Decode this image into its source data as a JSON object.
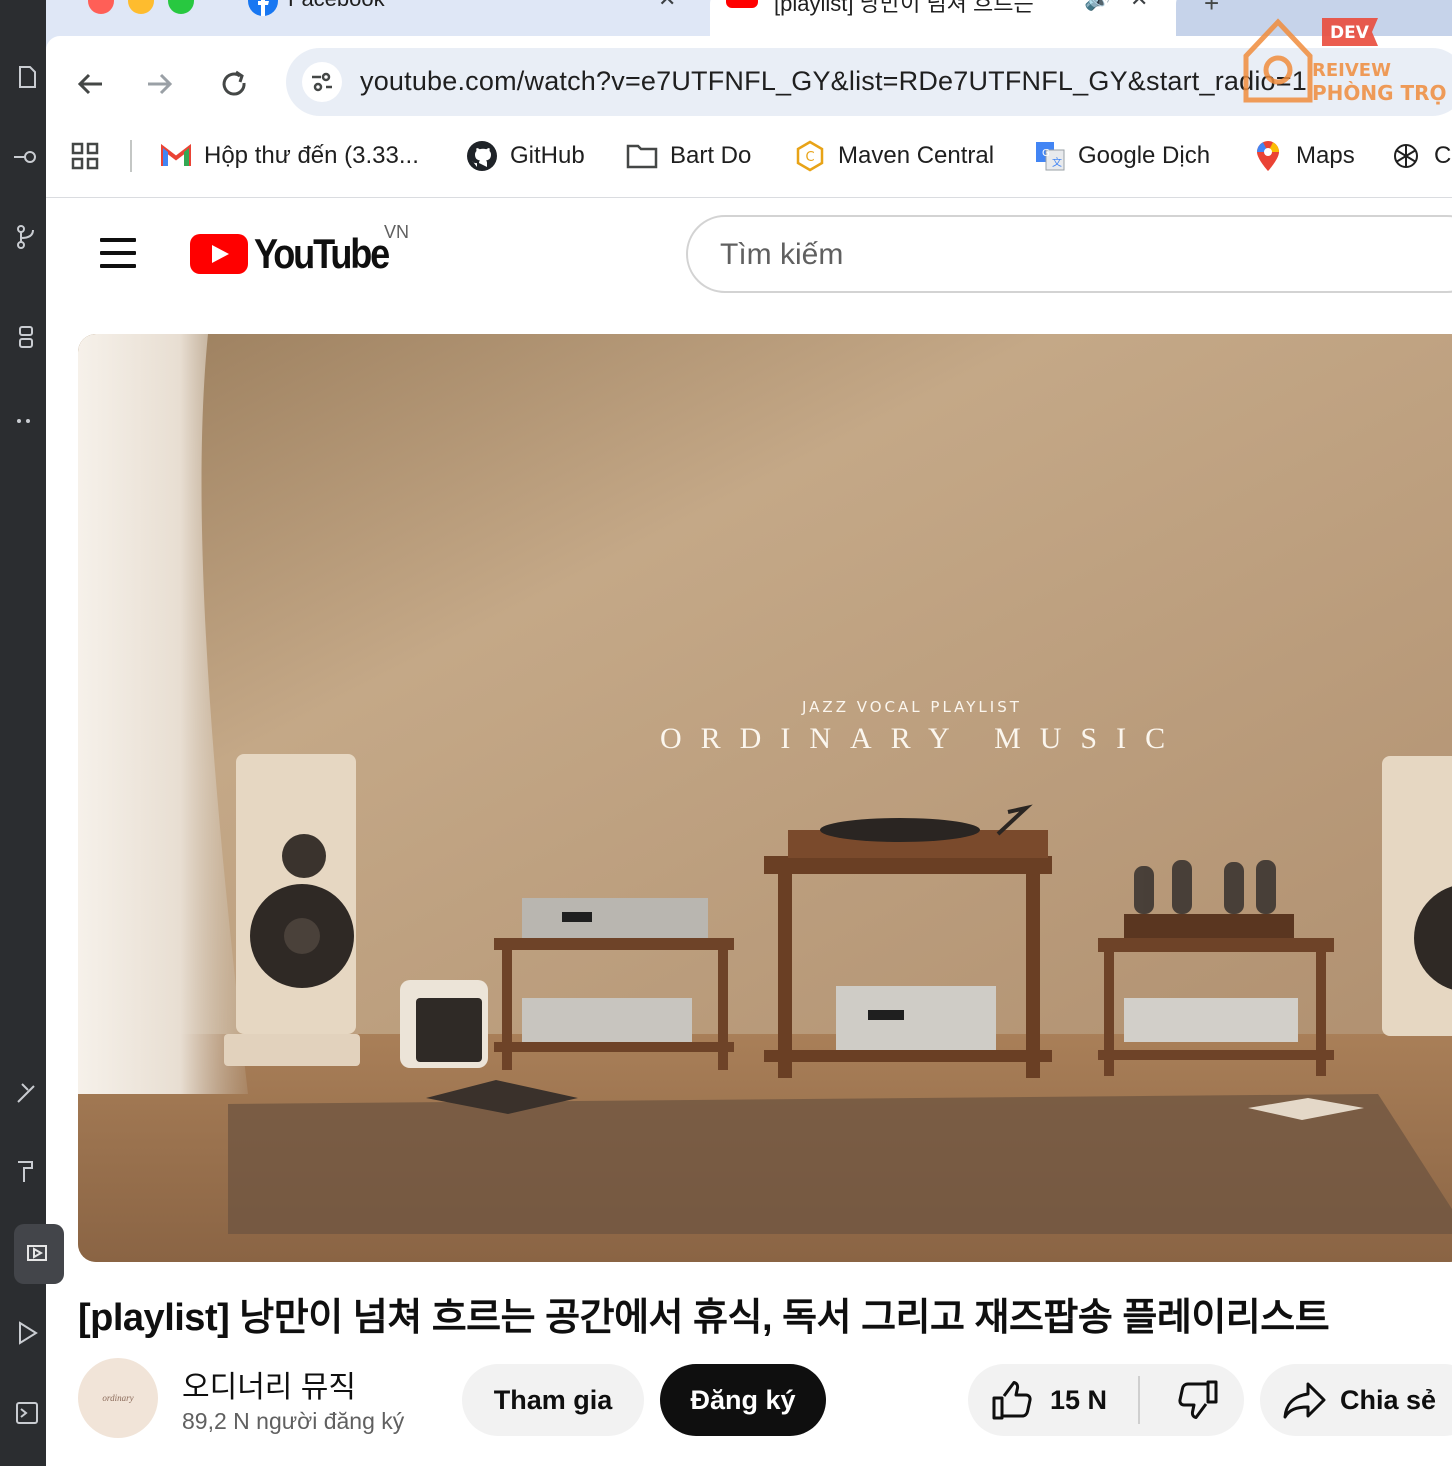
{
  "browser": {
    "tabs": [
      {
        "label": "Facebook"
      },
      {
        "label": "[playlist] 낭만이 넘쳐 흐르는"
      }
    ],
    "address": "youtube.com/watch?v=e7UTFNFL_GY&list=RDe7UTFNFL_GY&start_radio=1",
    "bookmarks": [
      {
        "label": "Hộp thư đến (3.33...",
        "icon": "gmail-icon"
      },
      {
        "label": "GitHub",
        "icon": "github-icon"
      },
      {
        "label": "Bart Do",
        "icon": "folder-icon"
      },
      {
        "label": "Maven Central",
        "icon": "maven-icon"
      },
      {
        "label": "Google Dịch",
        "icon": "google-translate-icon"
      },
      {
        "label": "Maps",
        "icon": "maps-icon"
      },
      {
        "label": "C",
        "icon": "chatgpt-icon"
      }
    ]
  },
  "watermark": {
    "badge": "DEV",
    "line1": "REIVEW",
    "line2": "PHÒNG TRỌ"
  },
  "youtube": {
    "logo_text": "YouTube",
    "region": "VN",
    "search_placeholder": "Tìm kiếm"
  },
  "video": {
    "overlay_subtitle": "JAZZ VOCAL PLAYLIST",
    "overlay_title": "ORDINARY MUSIC",
    "title": "[playlist] 낭만이 넘쳐 흐르는 공간에서 휴식, 독서 그리고 재즈팝송 플레이리스트"
  },
  "channel": {
    "avatar_text": "ordinary",
    "name": "오디너리 뮤직",
    "subscribers": "89,2 N người đăng ký",
    "join_label": "Tham gia",
    "subscribe_label": "Đăng ký"
  },
  "actions": {
    "like_count": "15 N",
    "share_label": "Chia sẻ"
  },
  "colors": {
    "youtube_red": "#ff0000",
    "chrome_frame": "#dfe7f6",
    "omnibox_bg": "#e9eef6",
    "button_bg": "#f2f2f2",
    "subscribe_bg": "#0f0f0f"
  }
}
